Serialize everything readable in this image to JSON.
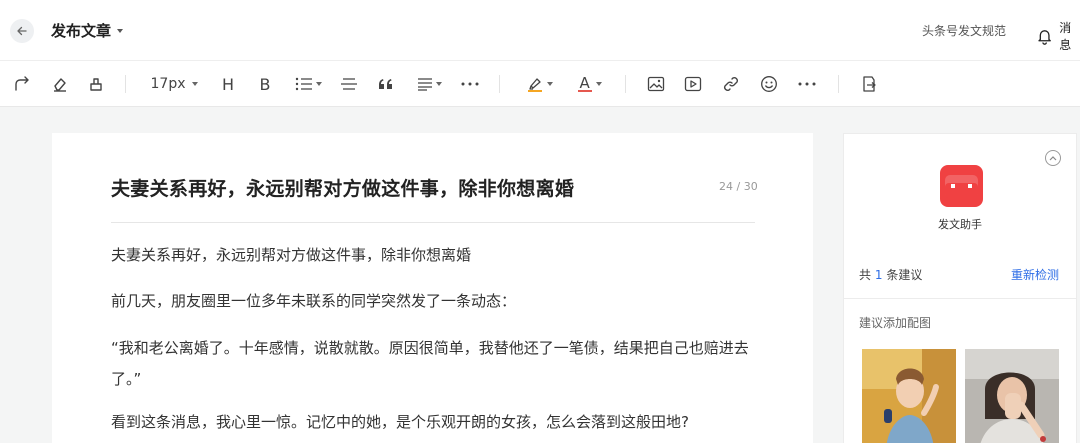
{
  "header": {
    "page_title": "发布文章",
    "rules_link": "头条号发文规范",
    "messages_label": "消息"
  },
  "toolbar": {
    "font_size": "17px",
    "heading_letter": "H",
    "bold_letter": "B",
    "text_color_letter": "A",
    "accent_color": "#e5584f",
    "highlight_color": "#f5a623"
  },
  "editor": {
    "title": "夫妻关系再好，永远别帮对方做这件事，除非你想离婚",
    "title_counter": "24 / 30",
    "paragraphs": [
      "夫妻关系再好，永远别帮对方做这件事，除非你想离婚",
      "前几天，朋友圈里一位多年未联系的同学突然发了一条动态：",
      "“我和老公离婚了。十年感情，说散就散。原因很简单，我替他还了一笔债，结果把自己也赔进去了。”",
      "看到这条消息，我心里一惊。记忆中的她，是个乐观开朗的女孩，怎么会落到这般田地?"
    ]
  },
  "assistant": {
    "name": "发文助手",
    "count_prefix": "共",
    "count_value": "1",
    "count_suffix": "条建议",
    "recheck": "重新检测",
    "suggest_label": "建议添加配图",
    "brand_color": "#f04142"
  }
}
